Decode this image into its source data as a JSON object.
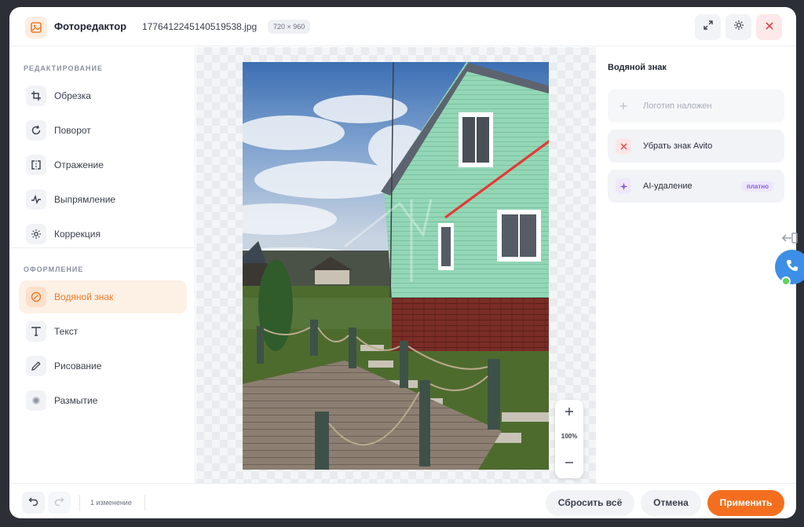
{
  "header": {
    "title": "Фоторедактор",
    "filename": "1776412245140519538.jpg",
    "dimensions": "720 × 960",
    "app_icon": "image-icon",
    "actions": [
      "expand-icon",
      "settings-icon",
      "close-icon"
    ]
  },
  "sidebar": {
    "section_edit": "РЕДАКТИРОВАНИЕ",
    "edit_tools": [
      {
        "label": "Обрезка",
        "icon": "crop-icon"
      },
      {
        "label": "Поворот",
        "icon": "rotate-icon"
      },
      {
        "label": "Отражение",
        "icon": "flip-icon"
      },
      {
        "label": "Выпрямление",
        "icon": "straighten-icon"
      },
      {
        "label": "Коррекция",
        "icon": "adjust-icon"
      }
    ],
    "section_design": "ОФОРМЛЕНИЕ",
    "design_tools": [
      {
        "label": "Водяной знак",
        "icon": "watermark-icon",
        "active": true
      },
      {
        "label": "Текст",
        "icon": "text-icon"
      },
      {
        "label": "Рисование",
        "icon": "pencil-icon"
      },
      {
        "label": "Размытие",
        "icon": "blur-icon"
      }
    ]
  },
  "canvas": {
    "zoom": "100%"
  },
  "right_panel": {
    "title": "Водяной знак",
    "options": [
      {
        "label": "Логотип наложен",
        "icon": "plus-icon",
        "disabled": true
      },
      {
        "label": "Убрать знак Avito",
        "icon": "x-icon"
      },
      {
        "label": "AI-удаление",
        "icon": "sparkle-icon",
        "badge": "платно"
      }
    ]
  },
  "footer": {
    "changes": "1 изменение",
    "reset_label": "Сбросить всё",
    "cancel_label": "Отмена",
    "apply_label": "Применить"
  },
  "colors": {
    "accent": "#f36f1f",
    "annotation_arrow": "#e53935",
    "siding": "#93d7b6"
  }
}
